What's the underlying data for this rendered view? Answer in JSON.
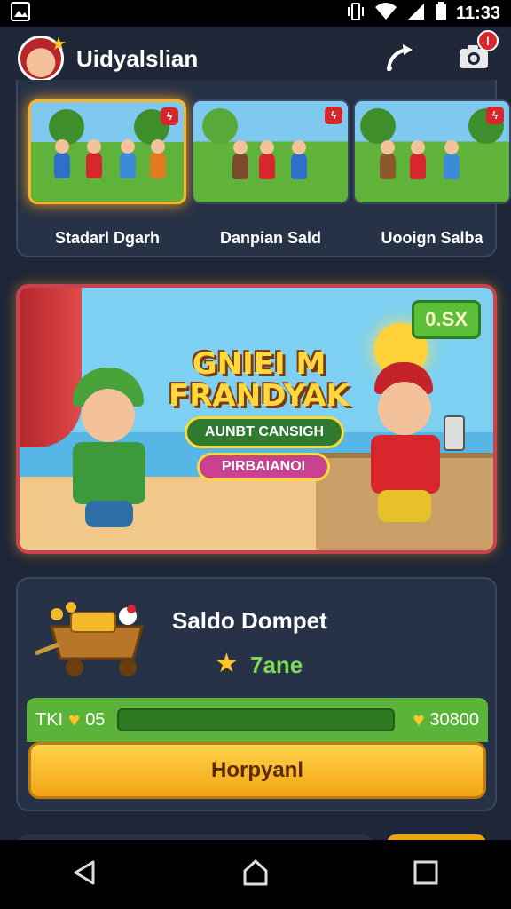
{
  "status_bar": {
    "time": "11:33"
  },
  "header": {
    "title": "Uidyalslian",
    "notification_count": "!"
  },
  "games": [
    {
      "label": "Stadarl Dgarh",
      "badge": "ϟ"
    },
    {
      "label": "Danpian Sald",
      "badge": "ϟ"
    },
    {
      "label": "Uooign Salba",
      "badge": "ϟ"
    }
  ],
  "banner": {
    "multiplier": "0.SX",
    "title_line1": "GNIEI M",
    "title_line2": "FRANDYAK",
    "subtitle": "AUNBT CANSIGH",
    "ribbon": "PIRBAIANOI"
  },
  "wallet": {
    "title": "Saldo Dompet",
    "balance": "7ane",
    "progress_label": "TKI",
    "progress_start": "05",
    "progress_end": "30800",
    "progress_fraction": 0.0,
    "claim_label": "Horpyanl"
  },
  "colors": {
    "background": "#1e2738",
    "panel": "#273246",
    "accent_gold": "#f7b62c",
    "accent_green": "#5bb33a",
    "badge_red": "#d8262d"
  },
  "icons": {
    "status_left": "image-notification-icon",
    "header_right_1": "share-icon",
    "header_right_2": "camera-icon",
    "nav": [
      "back-icon",
      "home-icon",
      "recents-icon"
    ]
  }
}
